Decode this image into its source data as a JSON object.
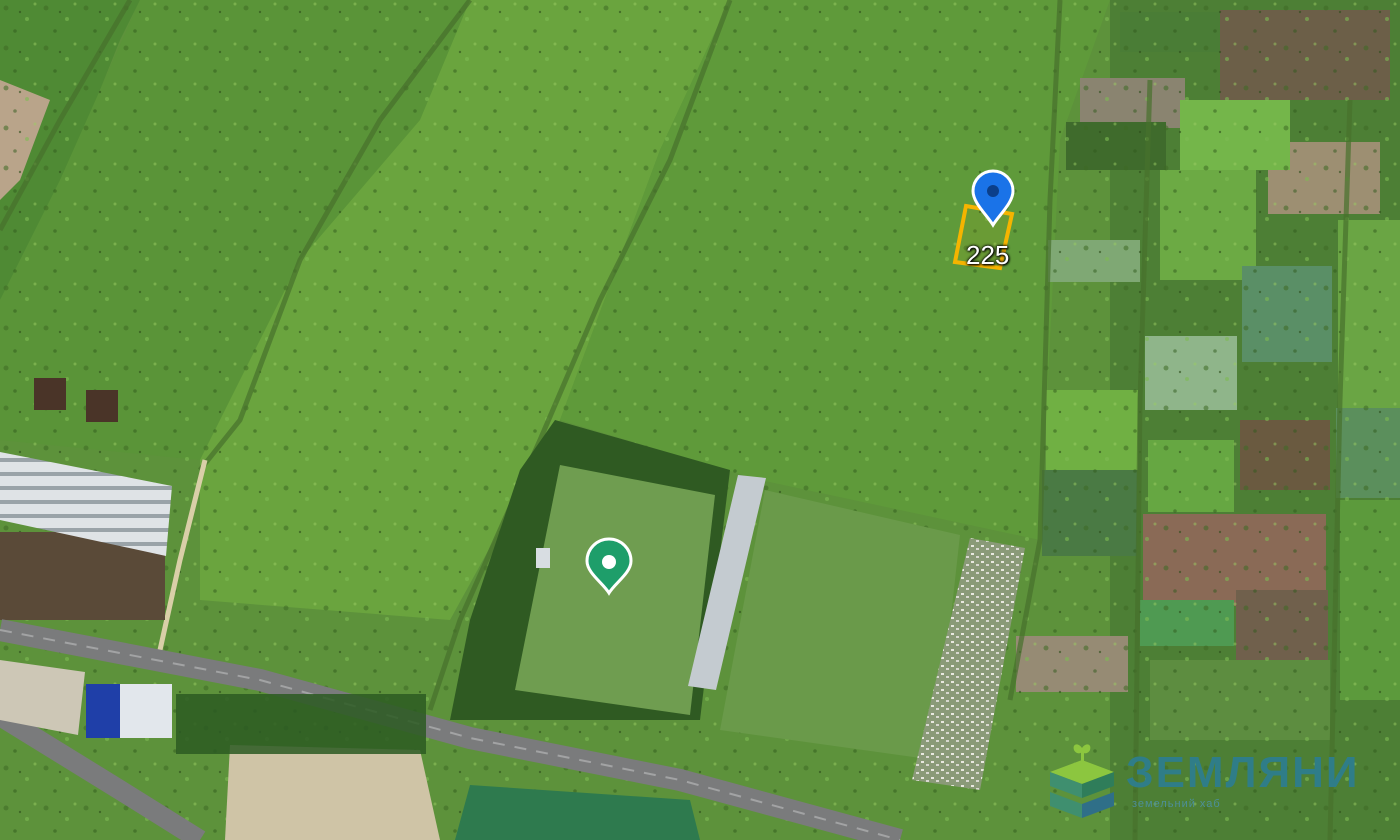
{
  "map": {
    "view": "satellite",
    "selected_parcel": {
      "label": "225",
      "outline_color": "#f5b400"
    },
    "markers": [
      {
        "name": "selected-location-pin",
        "color": "#1a73e8",
        "icon": "location-pin-icon"
      },
      {
        "name": "place-pin",
        "color": "#1e9e6a",
        "icon": "place-pin-icon"
      }
    ],
    "roads": [
      "main-road",
      "side-road"
    ]
  },
  "branding": {
    "name": "ЗЕМЛЯНИ",
    "tagline": "земельний хаб",
    "colors": {
      "text": "#2f7d88",
      "leaf": "#8cc63f",
      "layers": "#3f8f6f"
    }
  }
}
